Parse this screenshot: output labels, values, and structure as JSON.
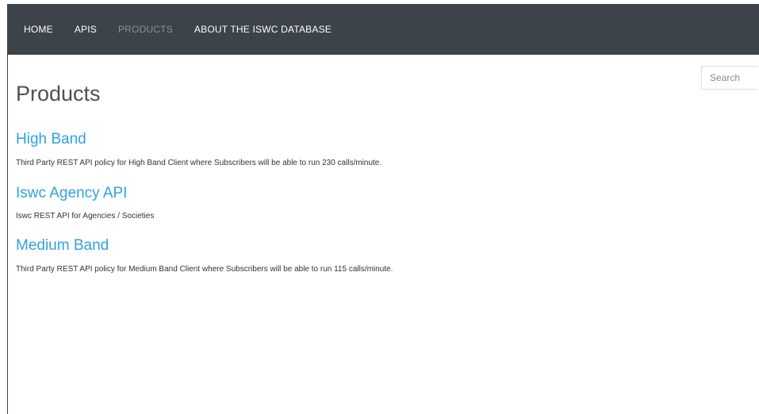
{
  "nav": {
    "items": [
      {
        "label": "HOME",
        "active": false
      },
      {
        "label": "APIS",
        "active": false
      },
      {
        "label": "PRODUCTS",
        "active": true
      },
      {
        "label": "ABOUT THE ISWC DATABASE",
        "active": false
      }
    ]
  },
  "search": {
    "placeholder": "Search"
  },
  "page": {
    "title": "Products"
  },
  "products": [
    {
      "name": "High Band",
      "description": "Third Party REST API policy for High Band Client where Subscribers will be able to run 230 calls/minute."
    },
    {
      "name": "Iswc Agency API",
      "description": "Iswc REST API for Agencies / Societies"
    },
    {
      "name": "Medium Band",
      "description": "Third Party REST API policy for Medium Band Client where Subscribers will be able to run 115 calls/minute."
    }
  ],
  "colors": {
    "navbar_bg": "#3d434a",
    "nav_text": "#ffffff",
    "nav_active": "#8a9099",
    "link": "#2fa3de",
    "title": "#505050"
  }
}
